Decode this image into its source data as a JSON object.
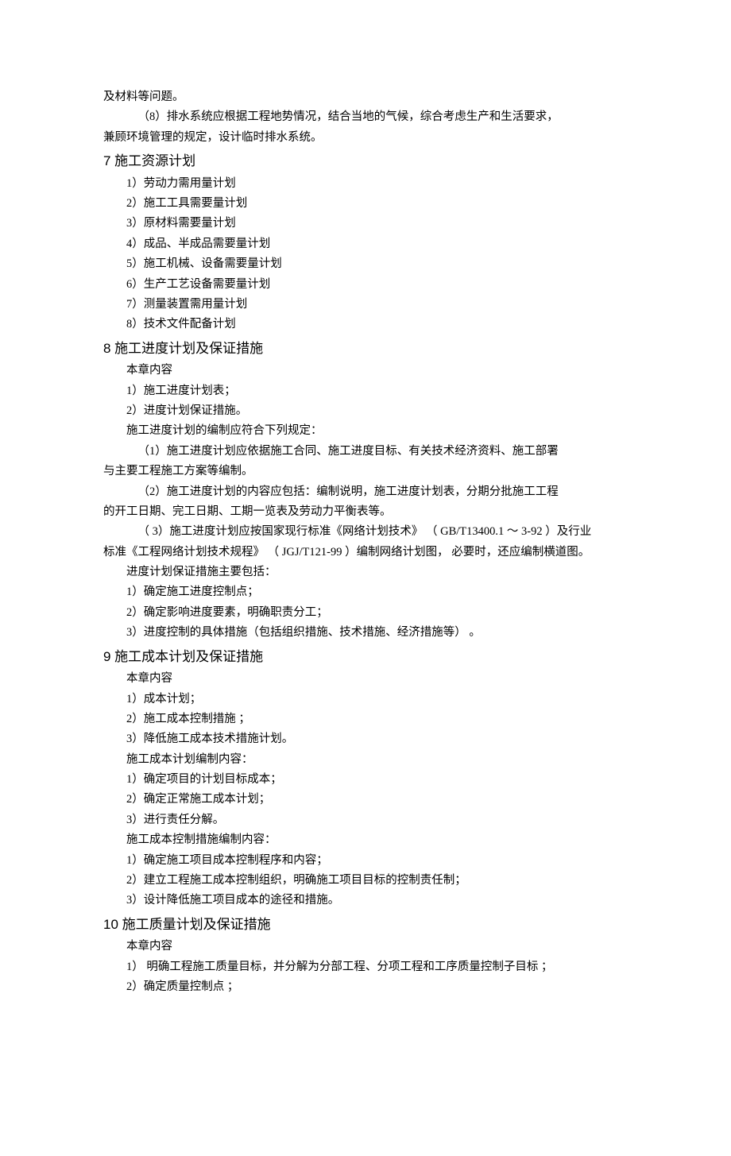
{
  "continued": {
    "line1": "及材料等问题。",
    "line2": "（8）排水系统应根据工程地势情况，结合当地的气候，综合考虑生产和生活要求，",
    "line3": "兼顾环境管理的规定，设计临时排水系统。"
  },
  "s7": {
    "heading": "7  施工资源计划",
    "items": [
      "1）劳动力需用量计划",
      "2）施工工具需要量计划",
      "3）原材料需要量计划",
      "4）成品、半成品需要量计划",
      "5）施工机械、设备需要量计划",
      "6）生产工艺设备需要量计划",
      "7）测量装置需用量计划",
      "8）技术文件配备计划"
    ]
  },
  "s8": {
    "heading": "8  施工进度计划及保证措施",
    "p0": "本章内容",
    "items1": [
      "1）施工进度计划表；",
      "2）进度计划保证措施。"
    ],
    "p1": "施工进度计划的编制应符合下列规定：",
    "r1a": "（1）施工进度计划应依据施工合同、施工进度目标、有关技术经济资料、施工部署",
    "r1b": "与主要工程施工方案等编制。",
    "r2a": "（2）施工进度计划的内容应包括：编制说明，施工进度计划表，分期分批施工工程",
    "r2b": "的开工日期、完工日期、工期一览表及劳动力平衡表等。",
    "r3a": "（ 3）施工进度计划应按国家现行标准《网络计划技术》      （ GB/T13400.1 ～ 3-92 ）及行业",
    "r3b": "标准《工程网络计划技术规程》  （ JGJ/T121-99 ）编制网络计划图，   必要时，还应编制横道图。",
    "p2": "进度计划保证措施主要包括：",
    "items2": [
      "1）确定施工进度控制点；",
      "2）确定影响进度要素，明确职责分工；",
      "3）进度控制的具体措施（包括组织措施、技术措施、经济措施等）         。"
    ]
  },
  "s9": {
    "heading": "9 施工成本计划及保证措施",
    "p0": "本章内容",
    "items1": [
      "1）成本计划；",
      "2）施工成本控制措施    ；",
      "3）降低施工成本技术措施计划。"
    ],
    "p1": "施工成本计划编制内容：",
    "items2": [
      "1）确定项目的计划目标成本；",
      "2）确定正常施工成本计划；",
      "3）进行责任分解。"
    ],
    "p2": "施工成本控制措施编制内容：",
    "items3": [
      "1）确定施工项目成本控制程序和内容；",
      "2）建立工程施工成本控制组织，明确施工项目目标的控制责任制；",
      "3）设计降低施工项目成本的途径和措施。"
    ]
  },
  "s10": {
    "heading": "10 施工质量计划及保证措施",
    "p0": "本章内容",
    "items": [
      "1）  明确工程施工质量目标，并分解为分部工程、分项工程和工序质量控制子目标                ；",
      "2）确定质量控制点    ；"
    ]
  }
}
